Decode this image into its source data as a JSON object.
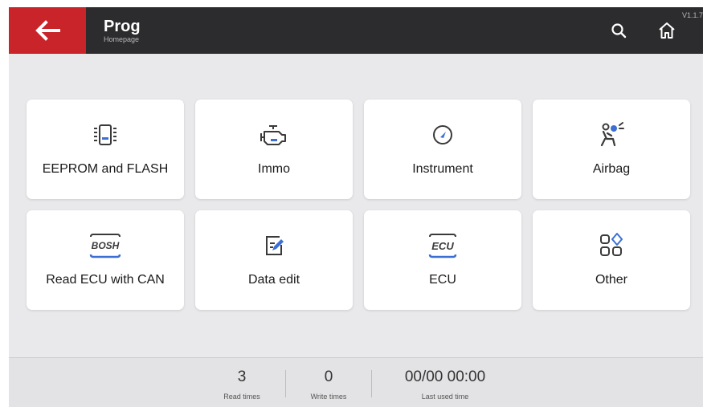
{
  "header": {
    "title": "Prog",
    "subtitle": "Homepage",
    "version": "V1.1.7",
    "icons": {
      "back": "back-arrow-icon",
      "search": "search-icon",
      "home": "home-icon"
    },
    "colors": {
      "bar": "#2c2c2e",
      "back": "#c8242a"
    }
  },
  "tiles": [
    {
      "label": "EEPROM and FLASH",
      "icon": "chip-icon"
    },
    {
      "label": "Immo",
      "icon": "engine-icon"
    },
    {
      "label": "Instrument",
      "icon": "gauge-icon"
    },
    {
      "label": "Airbag",
      "icon": "airbag-icon"
    },
    {
      "label": "Read ECU with CAN",
      "icon": "bosh-icon",
      "icon_text": "BOSH"
    },
    {
      "label": "Data edit",
      "icon": "edit-icon"
    },
    {
      "label": "ECU",
      "icon": "ecu-icon",
      "icon_text": "ECU"
    },
    {
      "label": "Other",
      "icon": "apps-icon"
    }
  ],
  "footer": {
    "read_value": "3",
    "read_caption": "Read times",
    "write_value": "0",
    "write_caption": "Write times",
    "last_value": "00/00 00:00",
    "last_caption": "Last used time"
  },
  "accent_color": "#3b6fd4"
}
